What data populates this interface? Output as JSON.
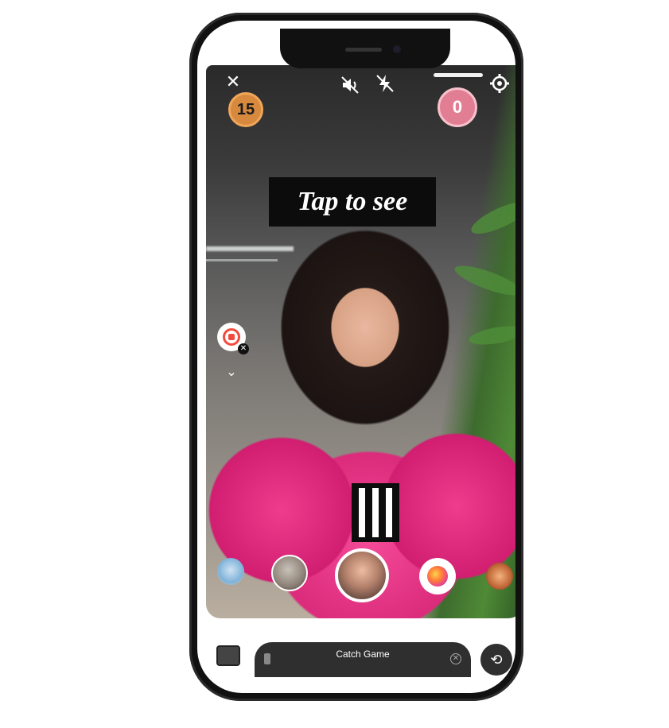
{
  "camera": {
    "close_icon": "close-icon",
    "timer_value": "15",
    "mute_icon": "sound-off-icon",
    "flash_icon": "flash-off-icon",
    "counter_value": "0",
    "settings_icon": "gear-icon",
    "sticker_text": "Tap to see",
    "side_record_icon": "record-icon",
    "side_close_label": "✕",
    "chevron_label": "⌄"
  },
  "effects_tray": {
    "items": [
      {
        "name": "effect-1"
      },
      {
        "name": "effect-2"
      },
      {
        "name": "effect-active",
        "selected": true
      },
      {
        "name": "effect-gradient-dot"
      },
      {
        "name": "effect-5"
      }
    ]
  },
  "bottom_bar": {
    "effect_name": "Catch Game",
    "close_label": "✕",
    "flip_icon": "flip-camera-icon"
  },
  "colors": {
    "timer_bg": "#d78a3e",
    "counter_bg": "#e27e93",
    "record_red": "#f24a3d"
  }
}
